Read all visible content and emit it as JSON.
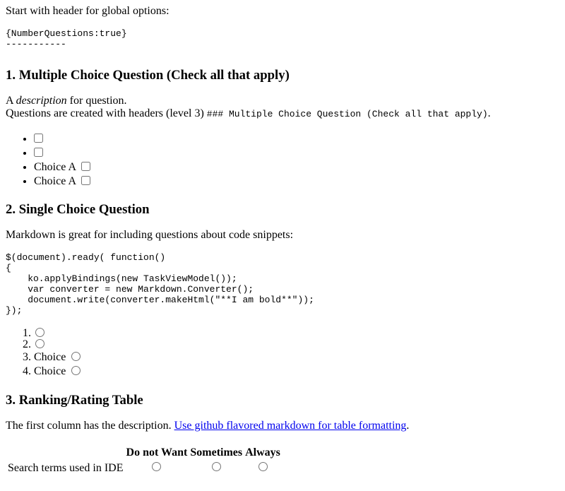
{
  "intro": {
    "text": "Start with header for global options:"
  },
  "options_code": "{NumberQuestions:true}\n-----------",
  "q1": {
    "title": "1. Multiple Choice Question (Check all that apply)",
    "desc_prefix": "A ",
    "desc_em": "description",
    "desc_suffix": " for question.",
    "line2_text": "Questions are created with headers (level 3) ",
    "line2_code": "### Multiple Choice Question (Check all that apply)",
    "line2_end": ".",
    "options": [
      {
        "label": ""
      },
      {
        "label": ""
      },
      {
        "label": "Choice A"
      },
      {
        "label": "Choice A"
      }
    ]
  },
  "q2": {
    "title": "2. Single Choice Question",
    "desc": "Markdown is great for including questions about code snippets:",
    "code": "$(document).ready( function()\n{\n    ko.applyBindings(new TaskViewModel());\n    var converter = new Markdown.Converter();\n    document.write(converter.makeHtml(\"**I am bold**\"));\n});",
    "options": [
      {
        "label": ""
      },
      {
        "label": ""
      },
      {
        "label": "Choice"
      },
      {
        "label": "Choice"
      }
    ]
  },
  "q3": {
    "title": "3. Ranking/Rating Table",
    "desc_prefix": "The first column has the description. ",
    "link_text": "Use github flavored markdown for table formatting",
    "desc_suffix": ".",
    "columns": [
      "",
      "Do not Want",
      "Sometimes",
      "Always"
    ],
    "rows": [
      {
        "label": "Search terms used in IDE"
      }
    ]
  }
}
